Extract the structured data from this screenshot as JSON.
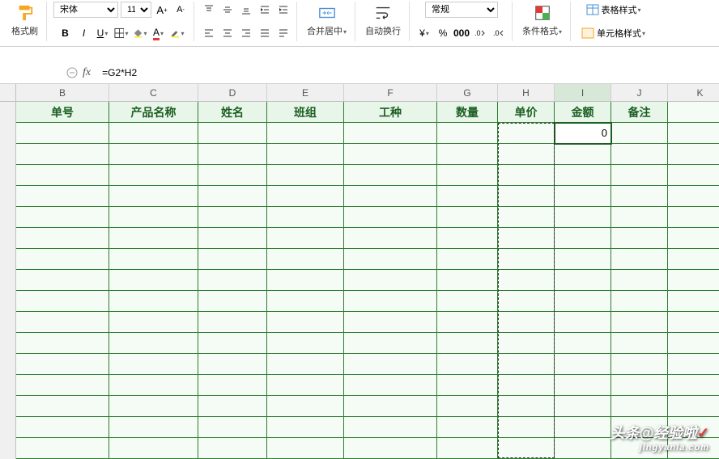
{
  "ribbon": {
    "format_painter": "格式刷",
    "font_name": "宋体",
    "font_size": "11",
    "merge_center": "合并居中",
    "wrap_text": "自动换行",
    "number_format": "常规",
    "cond_format": "条件格式",
    "table_style": "表格样式",
    "cell_style": "单元格样式"
  },
  "formula_bar": {
    "cell_ref": "",
    "formula": "=G2*H2"
  },
  "columns": [
    "B",
    "C",
    "D",
    "E",
    "F",
    "G",
    "H",
    "I",
    "J",
    "K"
  ],
  "headers": {
    "B": "单号",
    "C": "产品名称",
    "D": "姓名",
    "E": "班组",
    "F": "工种",
    "G": "数量",
    "H": "单价",
    "I": "金额",
    "J": "备注"
  },
  "data": {
    "I2": "0"
  },
  "active_column": "I",
  "watermark": {
    "main": "头条@经验啦",
    "sub": "jingyanla.com"
  }
}
